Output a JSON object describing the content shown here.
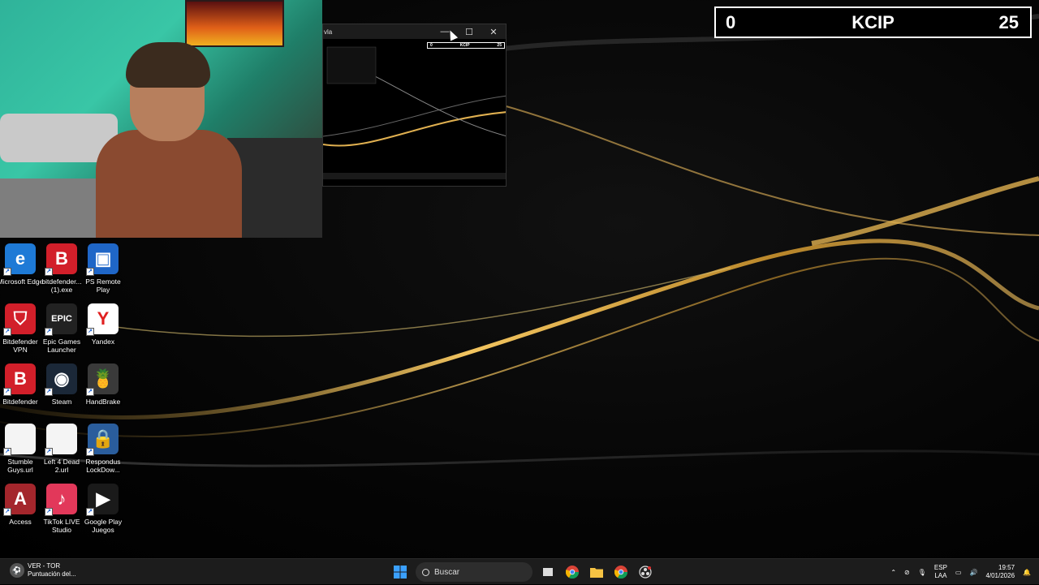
{
  "scoreboard": {
    "left_score": "0",
    "team": "KCIP",
    "right_score": "25"
  },
  "mini_window": {
    "title": "vla",
    "minimize": "—",
    "maximize": "☐",
    "close": "✕",
    "score_left": "0",
    "score_team": "KCIP",
    "score_right": "25"
  },
  "desktop_icons": [
    {
      "label": "Microsoft Edge",
      "glyph": "e",
      "color": "#1e7ad6"
    },
    {
      "label": "bitdefender... (1).exe",
      "glyph": "B",
      "color": "#d21f2a"
    },
    {
      "label": "PS Remote Play",
      "glyph": "▣",
      "color": "#1f66c7"
    },
    {
      "label": "Bitdefender VPN",
      "glyph": "⛉",
      "color": "#d21f2a"
    },
    {
      "label": "Epic Games Launcher",
      "glyph": "EPIC",
      "color": "#222222"
    },
    {
      "label": "Yandex",
      "glyph": "Y",
      "color": "#ffffff"
    },
    {
      "label": "Bitdefender",
      "glyph": "B",
      "color": "#d21f2a"
    },
    {
      "label": "Steam",
      "glyph": "◉",
      "color": "#1b2838"
    },
    {
      "label": "HandBrake",
      "glyph": "🍍",
      "color": "#3a3a3a"
    },
    {
      "label": "Stumble Guys.url",
      "glyph": "",
      "color": "#f4f4f4"
    },
    {
      "label": "Left 4 Dead 2.url",
      "glyph": "",
      "color": "#f4f4f4"
    },
    {
      "label": "Respondus LockDow...",
      "glyph": "🔒",
      "color": "#2a5d9c"
    },
    {
      "label": "Access",
      "glyph": "A",
      "color": "#a4262c"
    },
    {
      "label": "TikTok LIVE Studio",
      "glyph": "♪",
      "color": "#e2385a"
    },
    {
      "label": "Google Play Juegos",
      "glyph": "▶",
      "color": "#1a1a1a"
    }
  ],
  "taskbar": {
    "news_line1": "VER - TOR",
    "news_line2": "Puntuación del...",
    "search_placeholder": "Buscar",
    "lang_line1": "ESP",
    "lang_line2": "LAA",
    "time": "19:57",
    "date": "4/01/2026"
  }
}
